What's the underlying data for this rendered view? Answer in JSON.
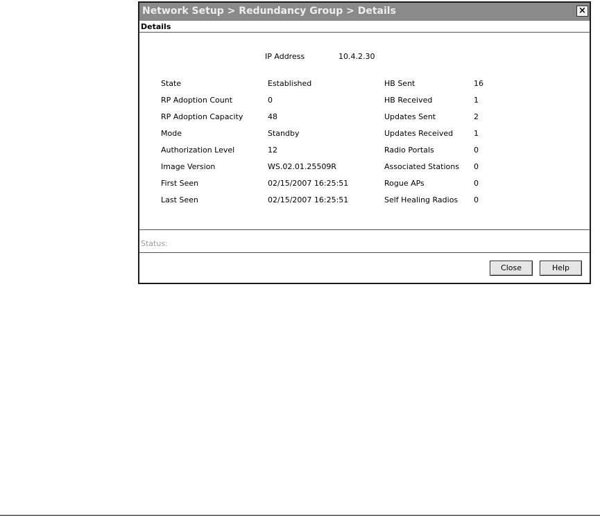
{
  "window": {
    "title": "Network Setup > Redundancy Group > Details",
    "close_glyph": "×",
    "section_label": "Details"
  },
  "ip": {
    "label": "IP Address",
    "value": "10.4.2.30"
  },
  "left_fields": [
    {
      "label": "State",
      "value": "Established"
    },
    {
      "label": "RP Adoption Count",
      "value": "0"
    },
    {
      "label": "RP Adoption Capacity",
      "value": "48"
    },
    {
      "label": "Mode",
      "value": "Standby"
    },
    {
      "label": "Authorization Level",
      "value": "12"
    },
    {
      "label": "Image Version",
      "value": "WS.02.01.25509R"
    },
    {
      "label": "First Seen",
      "value": "02/15/2007 16:25:51"
    },
    {
      "label": "Last Seen",
      "value": "02/15/2007 16:25:51"
    }
  ],
  "right_fields": [
    {
      "label": "HB Sent",
      "value": "16"
    },
    {
      "label": "HB Received",
      "value": "1"
    },
    {
      "label": "Updates Sent",
      "value": "2"
    },
    {
      "label": "Updates Received",
      "value": "1"
    },
    {
      "label": "Radio Portals",
      "value": "0"
    },
    {
      "label": "Associated Stations",
      "value": "0"
    },
    {
      "label": "Rogue APs",
      "value": "0"
    },
    {
      "label": "Self Healing Radios",
      "value": "0"
    }
  ],
  "status": {
    "label": "Status:"
  },
  "buttons": {
    "close_label": "Close",
    "help_label": "Help"
  }
}
